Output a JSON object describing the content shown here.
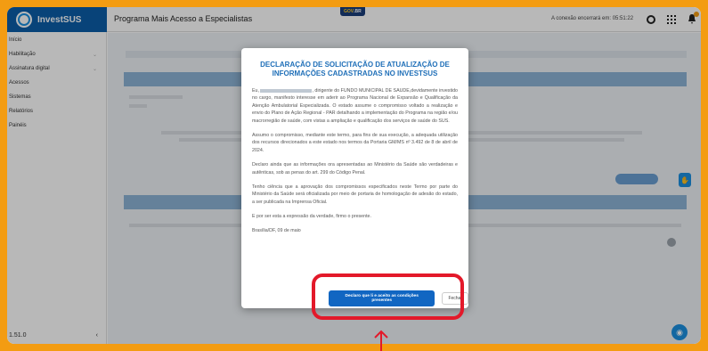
{
  "brand": {
    "name": "InvestSUS"
  },
  "header": {
    "title": "Programa Mais Acesso a Especialistas",
    "gov_badge_main": "GOV",
    "gov_badge_suffix": ".BR",
    "session": "A conexão encerrará em: 05:51:22"
  },
  "sidebar": {
    "items": [
      {
        "label": "Início"
      },
      {
        "label": "Habilitação"
      },
      {
        "label": "Assinatura digital"
      },
      {
        "label": "Acessos"
      },
      {
        "label": "Sistemas"
      },
      {
        "label": "Relatórios"
      },
      {
        "label": "Painéis"
      }
    ],
    "version": "1.51.0",
    "collapse_icon": "‹"
  },
  "modal": {
    "title": "DECLARAÇÃO DE SOLICITAÇÃO DE ATUALIZAÇÃO DE INFORMAÇÕES CADASTRADAS NO INVESTSUS",
    "p1_start": "Eu,",
    "p1_rest": ", dirigente do FUNDO MUNICIPAL DE SAUDE,devidamente investido no cargo, manifesto interesse em aderir ao Programa Nacional de Expansão e Qualificação da Atenção Ambulatorial Especializada. O estado assume o compromisso voltado a realização e envio do Plano de Ação Regional - PAR detalhando a implementação do Programa na região e/ou macrorregião de saúde, com vistas a ampliação e qualificação dos serviços de saúde do SUS.",
    "p2": "Assumo o compromisso, mediante este termo, para fins de sua execução, a adequada utilização dos recursos direcionados a este estado nos termos da Portaria GM/MS nº 3.492 de 8 de abril de 2024.",
    "p3": "Declaro ainda que as informações ora apresentadas ao Ministério da Saúde são verdadeiras e autênticas, sob as penas do art. 299 do Código Penal.",
    "p4": "Tenho ciência que a aprovação dos compromissos especificados neste Termo por parte do Ministério da Saúde será oficializada por meio de portaria de homologação de adesão do estado, a ser publicada na Imprensa Oficial.",
    "p5": "E por ser esta a expressão da verdade, firmo o presente.",
    "sign": "Brasília/DF, 09 de maio",
    "confirm_label": "Declaro que li e aceito as condições presentes",
    "close_label": "Fechar"
  },
  "colors": {
    "accent": "#1166c2",
    "frame": "#f39c12",
    "highlight": "#e3192a"
  }
}
